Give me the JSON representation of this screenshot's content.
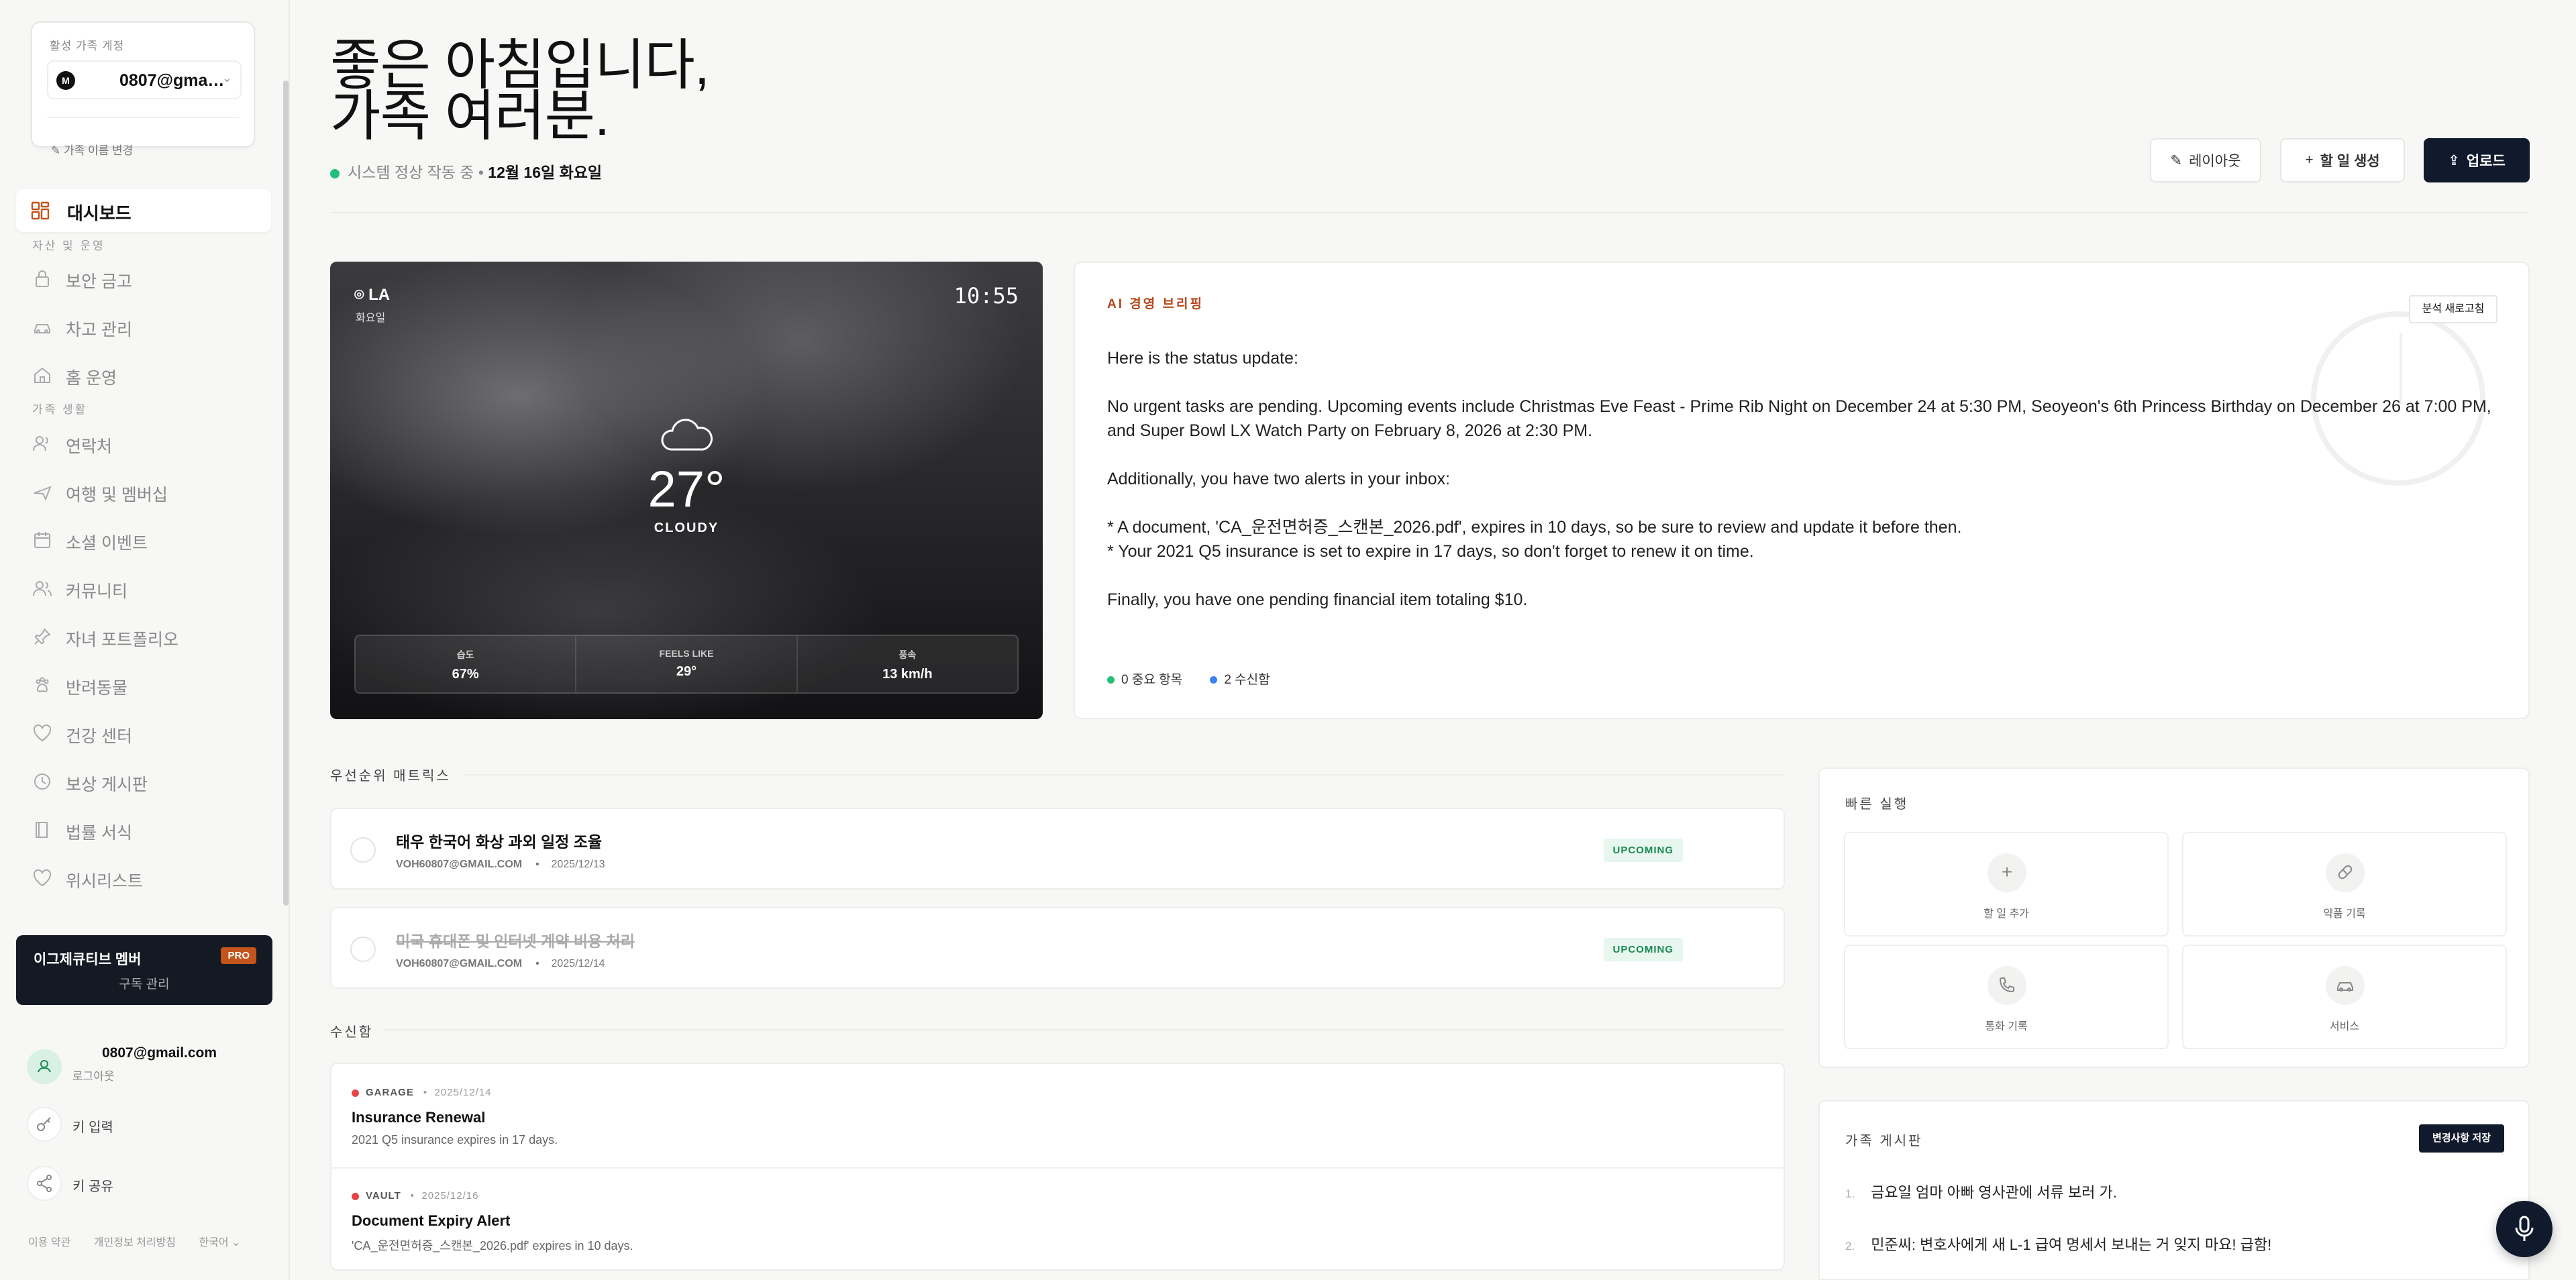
{
  "family_card": {
    "caption": "활성 가족 계정",
    "avatar_letter": "M",
    "email": "0807@gmail.com",
    "rename_label": "가족 이름 변경"
  },
  "nav": {
    "active": "대시보드",
    "section_assets": "자산 및 운영",
    "section_family": "가족 생활",
    "items_assets": [
      "보안 금고",
      "차고 관리",
      "홈 운영"
    ],
    "items_family": [
      "연락처",
      "여행 및 멤버십",
      "소셜 이벤트",
      "커뮤니티",
      "자녀 포트폴리오",
      "반려동물",
      "건강 센터",
      "보상 게시판",
      "법률 서식",
      "위시리스트"
    ]
  },
  "pro": {
    "title": "이그제큐티브 멤버",
    "badge": "PRO",
    "subtitle": "구독 관리"
  },
  "user": {
    "email": "0807@gmail.com",
    "logout": "로그아웃",
    "key_input": "키 입력",
    "key_share": "키 공유"
  },
  "footer": {
    "terms": "이용 약관",
    "privacy": "개인정보 처리방침",
    "language": "한국어 ⌄"
  },
  "header": {
    "greeting_line1": "좋은 아침입니다,",
    "greeting_line2": "가족 여러분.",
    "status": "시스템 정상 작동 중 •",
    "date": "12월 16일 화요일",
    "btn_layout": "레이아웃",
    "btn_new_task": "할 일 생성",
    "btn_upload": "업로드"
  },
  "weather": {
    "location": "LA",
    "day": "화요일",
    "time": "10:55",
    "temp": "27°",
    "condition": "CLOUDY",
    "stats": [
      {
        "label": "습도",
        "value": "67%"
      },
      {
        "label": "FEELS LIKE",
        "value": "29°"
      },
      {
        "label": "풍속",
        "value": "13 km/h"
      }
    ]
  },
  "briefing": {
    "title": "AI 경영 브리핑",
    "refresh": "분석 새로고침",
    "p1": "Here is the status update:",
    "p2": "No urgent tasks are pending. Upcoming events include Christmas Eve Feast - Prime Rib Night on December 24 at 5:30 PM, Seoyeon's 6th Princess Birthday on December 26 at 7:00 PM, and Super Bowl LX Watch Party on February 8, 2026 at 2:30 PM.",
    "p3": "Additionally, you have two alerts in your inbox:",
    "p4a": "* A document, 'CA_운전면허증_스캔본_2026.pdf', expires in 10 days, so be sure to review and update it before then.",
    "p4b": "* Your 2021 Q5 insurance is set to expire in 17 days, so don't forget to renew it on time.",
    "p5": "Finally, you have one pending financial item totaling $10.",
    "foot_important": "0 중요 항목",
    "foot_inbox": "2 수신함",
    "color_green": "#22c07a",
    "color_blue": "#3b82f6"
  },
  "priority": {
    "title": "우선순위 매트릭스",
    "tasks": [
      {
        "title": "태우 한국어 화상 과외 일정 조율",
        "owner": "VOH60807@GMAIL.COM",
        "date": "2025/12/13",
        "status": "UPCOMING"
      },
      {
        "title": "미국 휴대폰 및 인터넷 계약 비용 처리",
        "owner": "VOH60807@GMAIL.COM",
        "date": "2025/12/14",
        "status": "UPCOMING"
      }
    ]
  },
  "inbox": {
    "title": "수신함",
    "items": [
      {
        "tag": "GARAGE",
        "date": "2025/12/14",
        "title": "Insurance Renewal",
        "body": "2021 Q5 insurance expires in 17 days."
      },
      {
        "tag": "VAULT",
        "date": "2025/12/16",
        "title": "Document Expiry Alert",
        "body": "'CA_운전면허증_스캔본_2026.pdf' expires in 10 days."
      }
    ]
  },
  "quick": {
    "title": "빠른 실행",
    "actions": [
      {
        "label": "할 일 추가",
        "icon": "plus-icon"
      },
      {
        "label": "약품 기록",
        "icon": "pill-icon"
      },
      {
        "label": "통화 기록",
        "icon": "phone-icon"
      },
      {
        "label": "서비스",
        "icon": "car-icon"
      }
    ]
  },
  "board": {
    "title": "가족 게시판",
    "save": "변경사항 저장",
    "rows": [
      {
        "num": "1.",
        "text": "금요일 엄마 아빠 영사관에 서류 보러 가."
      },
      {
        "num": "2.",
        "text": "민준씨: 변호사에게 새 L-1 급여 명세서 보내는 거 잊지 마요! 급함!"
      }
    ]
  }
}
